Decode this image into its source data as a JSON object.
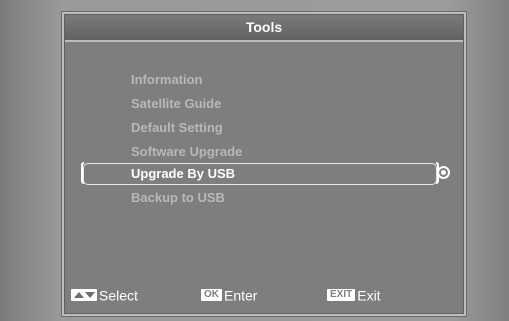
{
  "window": {
    "title": "Tools"
  },
  "menu": {
    "items": [
      {
        "label": "Information",
        "selected": false
      },
      {
        "label": "Satellite Guide",
        "selected": false
      },
      {
        "label": "Default Setting",
        "selected": false
      },
      {
        "label": "Software Upgrade",
        "selected": false
      },
      {
        "label": "Upgrade By USB",
        "selected": true
      },
      {
        "label": "Backup to USB",
        "selected": false
      }
    ],
    "selected_icon": "target-circle-icon"
  },
  "footer": {
    "hints": [
      {
        "key_icon": "up-down-arrows-icon",
        "label": "Select"
      },
      {
        "key": "OK",
        "label": "Enter"
      },
      {
        "key": "EXIT",
        "label": "Exit"
      }
    ]
  },
  "colors": {
    "window_bg": "#7e7e7e",
    "title_bg": "#6b6b6b",
    "item_text": "#b8b8b8",
    "selected_text": "#ffffff"
  }
}
